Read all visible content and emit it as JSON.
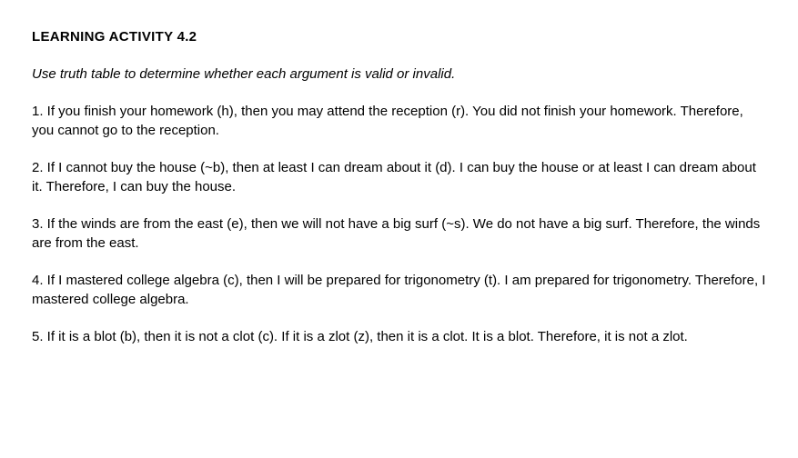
{
  "title": "LEARNING ACTIVITY 4.2",
  "instruction": "Use truth table to determine whether each argument is valid or invalid.",
  "problems": [
    "1. If you finish your homework (h), then you may attend the reception (r). You did not finish your homework. Therefore, you cannot go to the reception.",
    "2. If I cannot buy the house (~b), then at least I can dream about it (d). I can buy the house or at least I can dream about it. Therefore, I can buy the house.",
    "3. If the winds are from the east (e), then we will not have a big surf (~s). We do not have a big surf. Therefore, the winds are from the east.",
    "4. If I mastered college algebra (c), then I will be prepared for trigonometry (t). I am prepared for trigonometry. Therefore, I mastered college algebra.",
    "5. If it is a blot (b), then it is not a clot (c). If it is a zlot (z), then it is a clot. It is a blot. Therefore, it is not a zlot."
  ]
}
